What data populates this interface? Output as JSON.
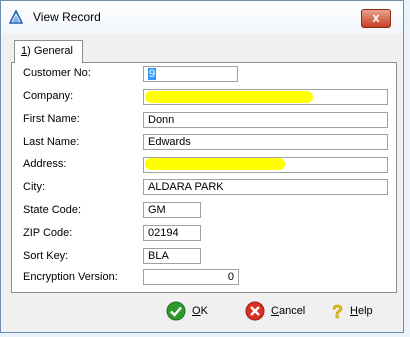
{
  "window": {
    "title": "View Record",
    "close_glyph": "x",
    "icon": "app-triangle-icon"
  },
  "tabs": [
    {
      "label_num": "1",
      "label_rest": ") General",
      "selected": true
    }
  ],
  "fields": {
    "customer_no": {
      "label": "Customer No:",
      "value": "9"
    },
    "company": {
      "label": "Company:",
      "value": ""
    },
    "first_name": {
      "label": "First Name:",
      "value": "Donn"
    },
    "last_name": {
      "label": "Last Name:",
      "value": "Edwards"
    },
    "address": {
      "label": "Address:",
      "value": ""
    },
    "city": {
      "label": "City:",
      "value": "ALDARA PARK"
    },
    "state_code": {
      "label": "State Code:",
      "value": "GM"
    },
    "zip_code": {
      "label": "ZIP Code:",
      "value": "02194"
    },
    "sort_key": {
      "label": "Sort Key:",
      "value": "BLA"
    },
    "encryption_version": {
      "label": "Encryption Version:",
      "value": "0"
    }
  },
  "buttons": {
    "ok": {
      "u": "O",
      "rest": "K",
      "icon": "checkmark-icon",
      "color": "#2e9a2e"
    },
    "cancel": {
      "u": "C",
      "rest": "ancel",
      "icon": "cancel-x-icon",
      "color": "#d93025"
    },
    "help": {
      "u": "H",
      "rest": "elp",
      "icon": "question-icon",
      "color": "#e8c400"
    }
  },
  "colors": {
    "redaction": "#ffff00",
    "selection": "#3399ff"
  }
}
